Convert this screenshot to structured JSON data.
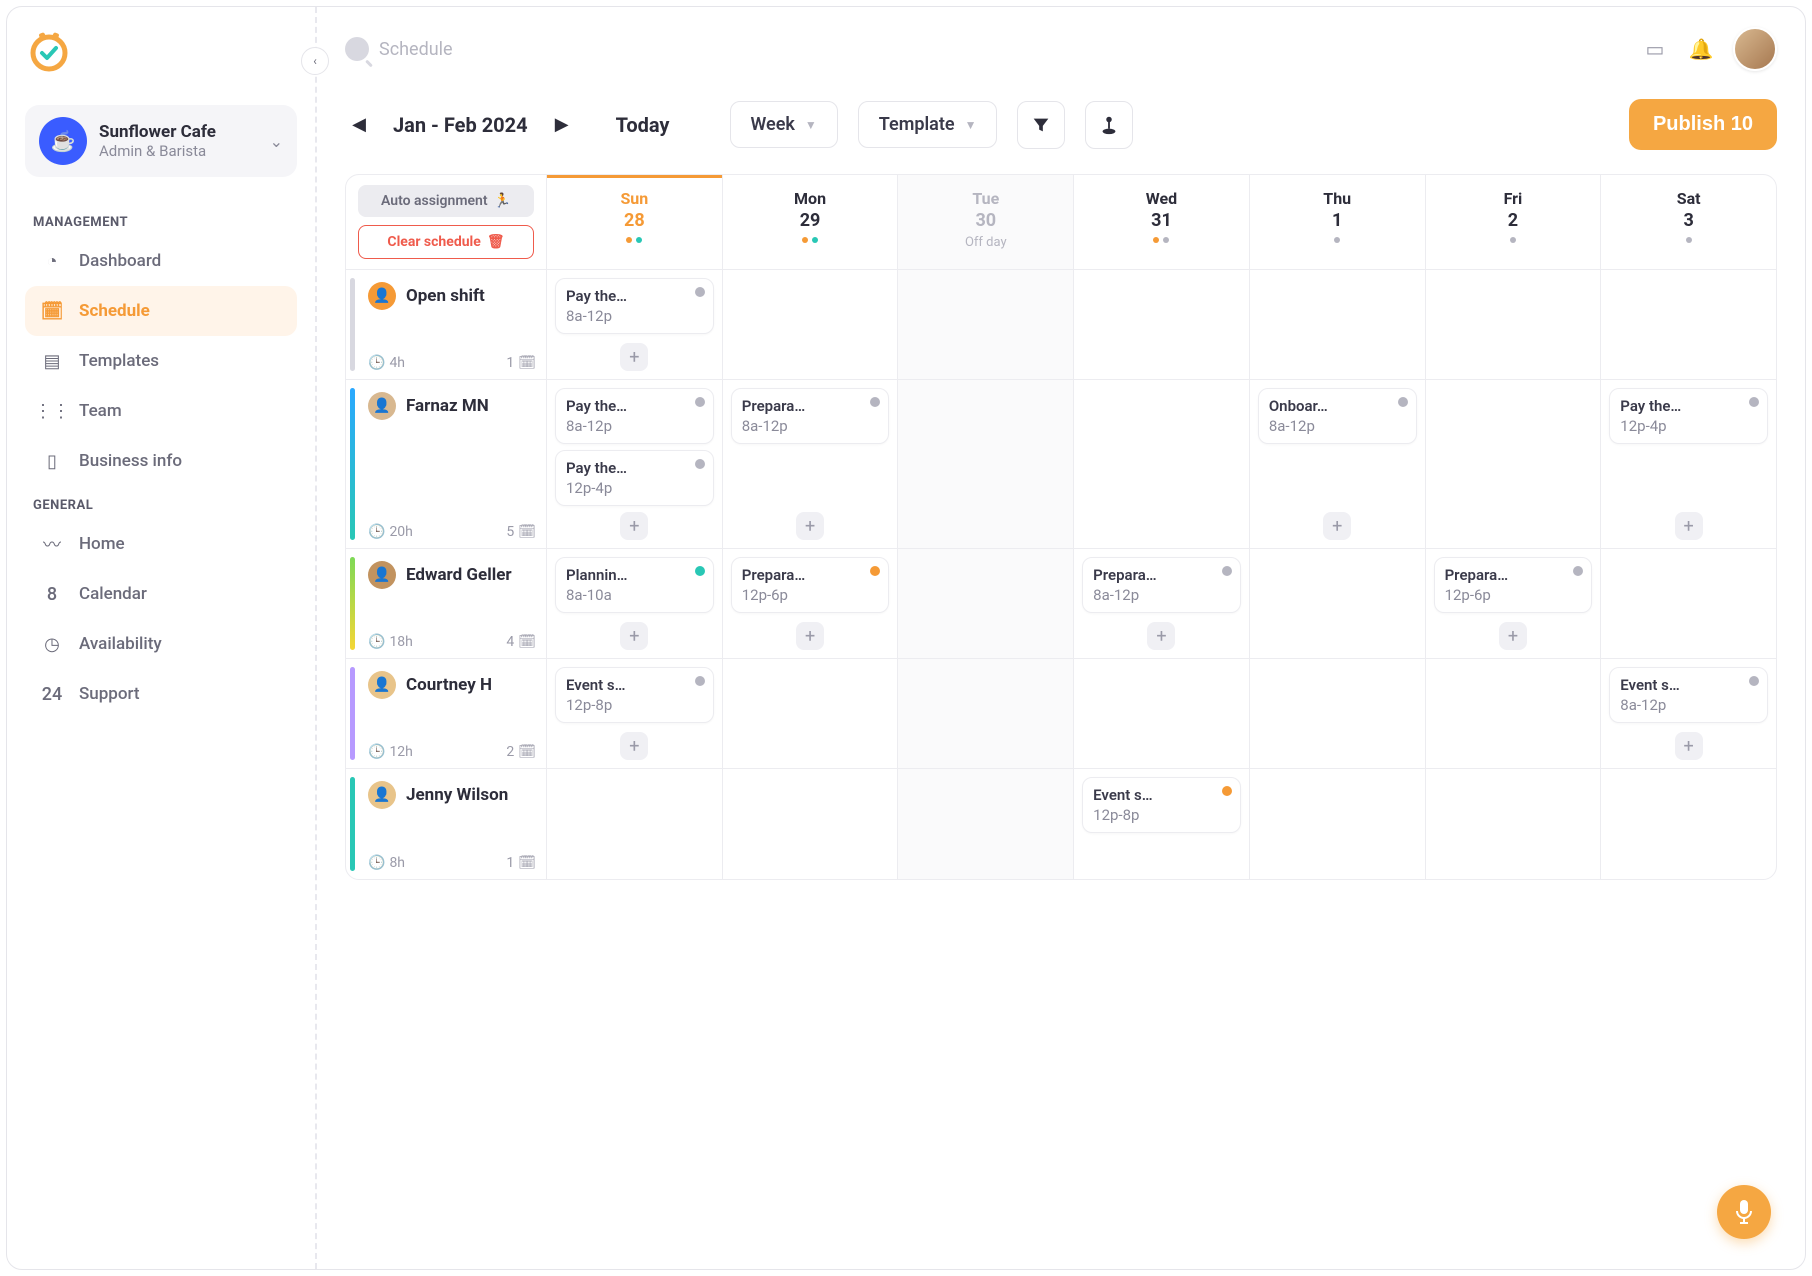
{
  "search": {
    "placeholder": "Schedule"
  },
  "workspace": {
    "name": "Sunflower Cafe",
    "role": "Admin & Barista"
  },
  "sidebar": {
    "sections": [
      {
        "label": "MANAGEMENT",
        "items": [
          {
            "key": "dashboard",
            "label": "Dashboard",
            "icon": "◔"
          },
          {
            "key": "schedule",
            "label": "Schedule",
            "icon": "🗓",
            "active": true
          },
          {
            "key": "templates",
            "label": "Templates",
            "icon": "▤"
          },
          {
            "key": "team",
            "label": "Team",
            "icon": "⋮⋮"
          },
          {
            "key": "business",
            "label": "Business info",
            "icon": "▯"
          }
        ]
      },
      {
        "label": "GENERAL",
        "items": [
          {
            "key": "home",
            "label": "Home",
            "icon": "〰"
          },
          {
            "key": "calendar",
            "label": "Calendar",
            "icon": "8"
          },
          {
            "key": "availability",
            "label": "Availability",
            "icon": "◷"
          },
          {
            "key": "support",
            "label": "Support",
            "icon": "24"
          }
        ]
      }
    ]
  },
  "toolbar": {
    "date_range": "Jan - Feb 2024",
    "today": "Today",
    "view": "Week",
    "template": "Template",
    "publish": "Publish 10"
  },
  "header_actions": {
    "auto": "Auto assignment",
    "clear": "Clear schedule"
  },
  "days": [
    {
      "name": "Sun",
      "num": "28",
      "today": true,
      "dots": [
        "#f59a36",
        "#29c7b5"
      ]
    },
    {
      "name": "Mon",
      "num": "29",
      "dots": [
        "#f59a36",
        "#29c7b5"
      ]
    },
    {
      "name": "Tue",
      "num": "30",
      "off": true,
      "sub": "Off day"
    },
    {
      "name": "Wed",
      "num": "31",
      "dots": [
        "#f59a36",
        "#b5b5c0"
      ]
    },
    {
      "name": "Thu",
      "num": "1",
      "dots": [
        "#b5b5c0"
      ]
    },
    {
      "name": "Fri",
      "num": "2",
      "dots": [
        "#b5b5c0"
      ]
    },
    {
      "name": "Sat",
      "num": "3",
      "dots": [
        "#b5b5c0"
      ]
    }
  ],
  "rows": [
    {
      "name": "Open shift",
      "bar": "#d8d8e0",
      "avbg": "#f59a36",
      "hours": "4h",
      "count": "1",
      "cells": [
        {
          "shifts": [
            {
              "title": "Pay the…",
              "time": "8a-12p",
              "dot": "#b5b5c0"
            }
          ],
          "add": true
        },
        {},
        {
          "off": true
        },
        {},
        {},
        {},
        {}
      ]
    },
    {
      "name": "Farnaz MN",
      "bar": "linear-gradient(#2aa8ff,#29c7b5)",
      "avbg": "#d8b890",
      "hours": "20h",
      "count": "5",
      "cells": [
        {
          "shifts": [
            {
              "title": "Pay the…",
              "time": "8a-12p",
              "dot": "#b5b5c0"
            },
            {
              "title": "Pay the…",
              "time": "12p-4p",
              "dot": "#b5b5c0"
            }
          ],
          "add": true
        },
        {
          "shifts": [
            {
              "title": "Prepara…",
              "time": "8a-12p",
              "dot": "#b5b5c0"
            }
          ],
          "add": true
        },
        {
          "off": true
        },
        {},
        {
          "shifts": [
            {
              "title": "Onboar…",
              "time": "8a-12p",
              "dot": "#b5b5c0"
            }
          ],
          "add": true
        },
        {},
        {
          "shifts": [
            {
              "title": "Pay the…",
              "time": "12p-4p",
              "dot": "#b5b5c0"
            }
          ],
          "add": true
        }
      ]
    },
    {
      "name": "Edward Geller",
      "bar": "linear-gradient(#7ed957,#f5d635)",
      "avbg": "#c2935f",
      "hours": "18h",
      "count": "4",
      "cells": [
        {
          "shifts": [
            {
              "title": "Plannin…",
              "time": "8a-10a",
              "dot": "#29c7b5"
            }
          ],
          "add": true
        },
        {
          "shifts": [
            {
              "title": "Prepara…",
              "time": "12p-6p",
              "dot": "#f59a36"
            }
          ],
          "add": true
        },
        {
          "off": true
        },
        {
          "shifts": [
            {
              "title": "Prepara…",
              "time": "8a-12p",
              "dot": "#b5b5c0"
            }
          ],
          "add": true
        },
        {},
        {
          "shifts": [
            {
              "title": "Prepara…",
              "time": "12p-6p",
              "dot": "#b5b5c0"
            }
          ],
          "add": true
        },
        {}
      ]
    },
    {
      "name": "Courtney H",
      "bar": "#b79aff",
      "avbg": "#e8c48a",
      "hours": "12h",
      "count": "2",
      "cells": [
        {
          "shifts": [
            {
              "title": "Event s…",
              "time": "12p-8p",
              "dot": "#b5b5c0"
            }
          ],
          "add": true
        },
        {},
        {
          "off": true
        },
        {},
        {},
        {},
        {
          "shifts": [
            {
              "title": "Event s…",
              "time": "8a-12p",
              "dot": "#b5b5c0"
            }
          ],
          "add": true
        }
      ]
    },
    {
      "name": "Jenny Wilson",
      "bar": "#29c7b5",
      "avbg": "#e8c48a",
      "hours": "8h",
      "count": "1",
      "cells": [
        {},
        {},
        {
          "off": true
        },
        {
          "shifts": [
            {
              "title": "Event s…",
              "time": "12p-8p",
              "dot": "#f59a36"
            }
          ]
        },
        {},
        {},
        {}
      ]
    }
  ]
}
